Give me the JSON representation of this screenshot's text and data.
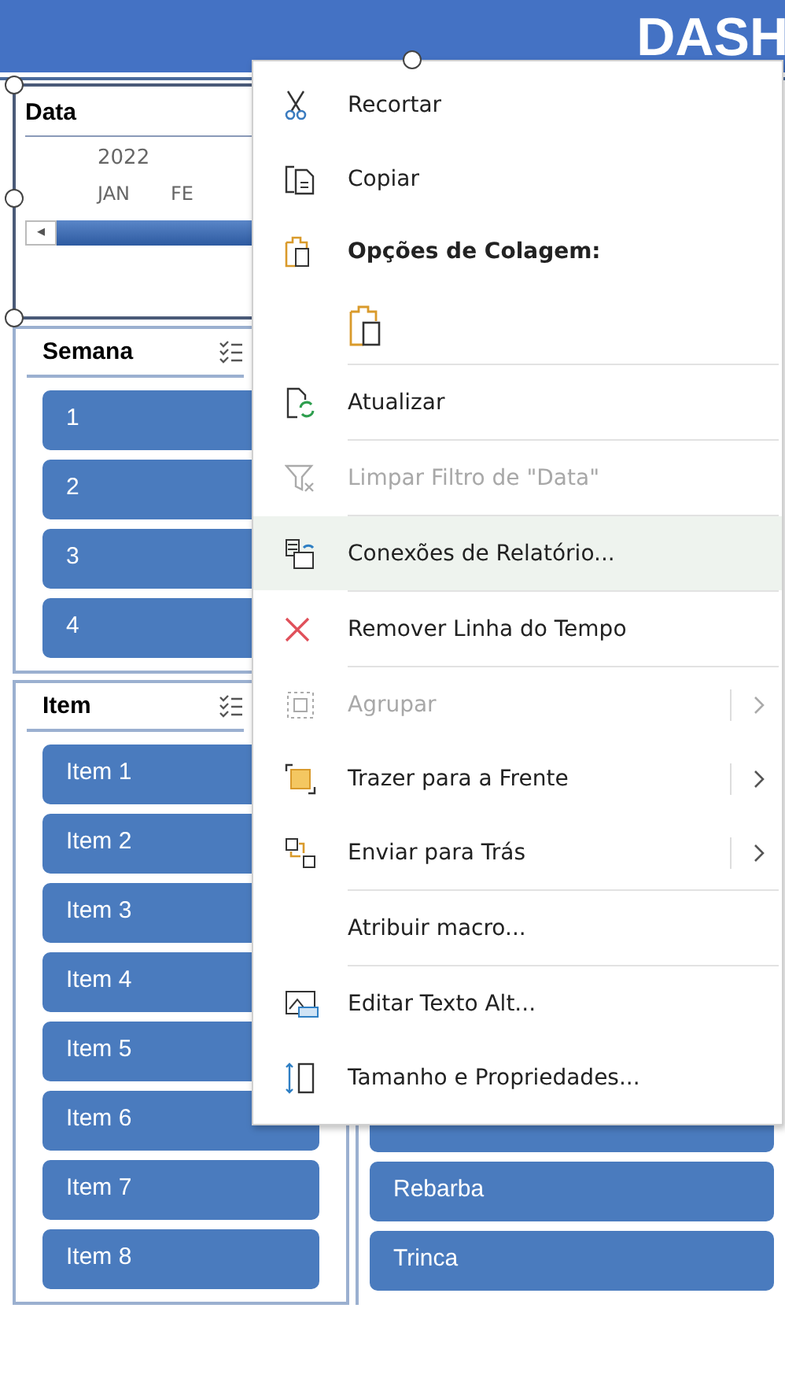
{
  "header": {
    "title": "DASH"
  },
  "timeline": {
    "title": "Data",
    "year": "2022",
    "months": [
      "JAN",
      "FE"
    ],
    "scroll_arrow": "◂"
  },
  "slicers": [
    {
      "title": "Semana",
      "items": [
        {
          "label": "1",
          "selected": true
        },
        {
          "label": "2",
          "selected": true
        },
        {
          "label": "3",
          "selected": true
        },
        {
          "label": "4",
          "selected": true
        }
      ]
    },
    {
      "title": "Item",
      "items": [
        {
          "label": "Item 1",
          "selected": true
        },
        {
          "label": "Item 2",
          "selected": true
        },
        {
          "label": "Item 3",
          "selected": true
        },
        {
          "label": "Item 4",
          "selected": true
        },
        {
          "label": "Item 5",
          "selected": true
        },
        {
          "label": "Item 6",
          "selected": true
        },
        {
          "label": "Item 7",
          "selected": true
        },
        {
          "label": "Item 8",
          "selected": true
        }
      ]
    }
  ],
  "right_slicer": {
    "items": [
      {
        "selected": true
      },
      {
        "label": "Rebarba",
        "selected": true
      },
      {
        "label": "Trinca",
        "selected": true
      }
    ]
  },
  "context_menu": {
    "items": [
      {
        "kind": "item",
        "label": "Recortar",
        "disabled": false,
        "selected": false,
        "submenu": false
      },
      {
        "kind": "item",
        "label": "Copiar",
        "disabled": false,
        "selected": false,
        "submenu": false
      },
      {
        "kind": "header",
        "label": "Opções de Colagem:"
      },
      {
        "kind": "paste-options"
      },
      {
        "kind": "separator"
      },
      {
        "kind": "item",
        "label": "Atualizar",
        "disabled": false,
        "selected": false,
        "submenu": false
      },
      {
        "kind": "separator"
      },
      {
        "kind": "item",
        "label": "Limpar Filtro de \"Data\"",
        "disabled": true,
        "selected": false,
        "submenu": false
      },
      {
        "kind": "separator"
      },
      {
        "kind": "item",
        "label": "Conexões de Relatório...",
        "disabled": false,
        "selected": true,
        "submenu": false
      },
      {
        "kind": "separator"
      },
      {
        "kind": "item",
        "label": "Remover Linha do Tempo",
        "disabled": false,
        "selected": false,
        "submenu": false
      },
      {
        "kind": "separator"
      },
      {
        "kind": "item",
        "label": "Agrupar",
        "disabled": true,
        "selected": false,
        "submenu": true
      },
      {
        "kind": "item",
        "label": "Trazer para a Frente",
        "disabled": false,
        "selected": false,
        "submenu": true
      },
      {
        "kind": "item",
        "label": "Enviar para Trás",
        "disabled": false,
        "selected": false,
        "submenu": true
      },
      {
        "kind": "separator"
      },
      {
        "kind": "item",
        "label": "Atribuir macro...",
        "disabled": false,
        "selected": false,
        "submenu": false
      },
      {
        "kind": "separator"
      },
      {
        "kind": "item",
        "label": "Editar Texto Alt...",
        "disabled": false,
        "selected": false,
        "submenu": false
      },
      {
        "kind": "item",
        "label": "Tamanho e Propriedades...",
        "disabled": false,
        "selected": false,
        "submenu": false
      }
    ]
  }
}
